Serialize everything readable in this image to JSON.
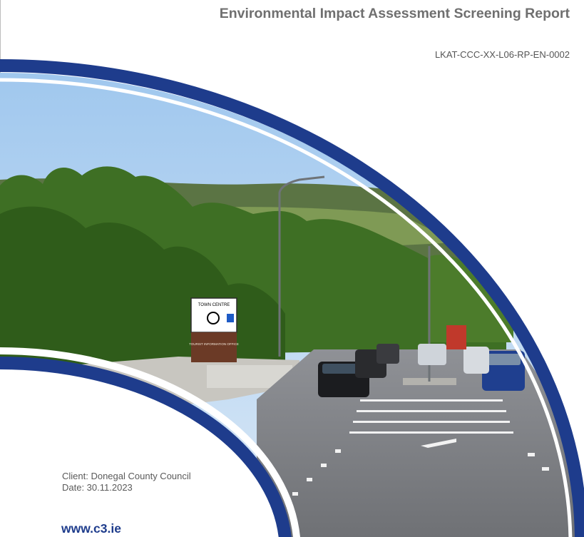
{
  "header": {
    "title": "Environmental Impact Assessment Screening Report",
    "document_reference": "LKAT-CCC-XX-L06-RP-EN-0002"
  },
  "cover_photo": {
    "signs": {
      "town_centre": "TOWN CENTRE",
      "tourist_info": "TOURIST INFORMATION OFFICE"
    }
  },
  "footer": {
    "client": "Client: Donegal County Council",
    "date": "Date: 30.11.2023",
    "website": "www.c3.ie"
  },
  "colors": {
    "brand_blue": "#1e3c8c",
    "title_grey": "#6f6f6f"
  }
}
